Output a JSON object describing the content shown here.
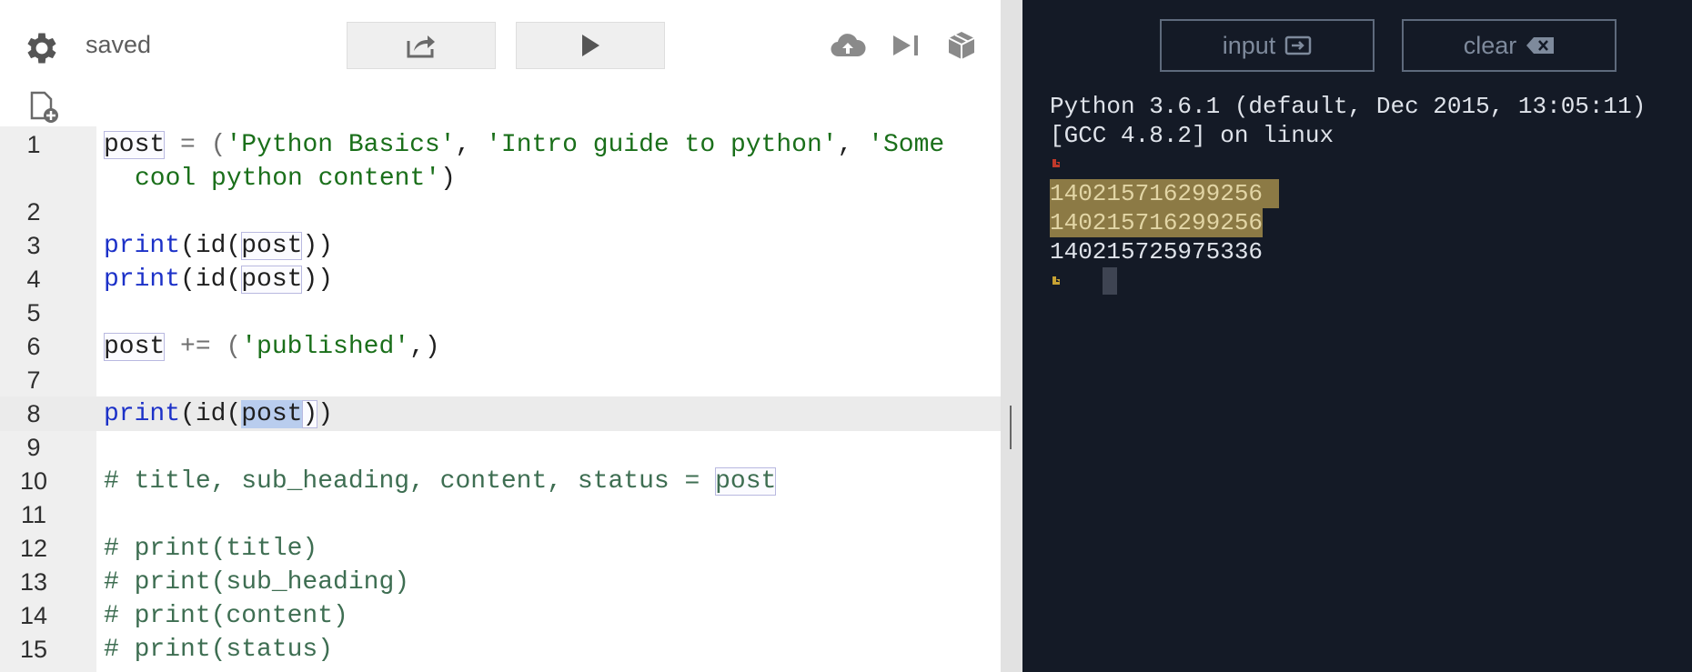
{
  "toolbar": {
    "status": "saved"
  },
  "editor": {
    "line_numbers": [
      "1",
      "2",
      "3",
      "4",
      "5",
      "6",
      "7",
      "8",
      "9",
      "10",
      "11",
      "12",
      "13",
      "14",
      "15"
    ],
    "current_line": "8",
    "code": {
      "l1a_var": "post",
      "l1a_op": " = (",
      "l1a_s1": "'Python Basics'",
      "l1a_c1": ", ",
      "l1a_s2": "'Intro guide to python'",
      "l1a_c2": ", ",
      "l1a_s3": "'Some",
      "l1b_s3": "cool python content'",
      "l1b_close": ")",
      "print_fn": "print",
      "id_open": "(id(",
      "var": "post",
      "close2": "))",
      "l6_op": " += (",
      "l6_str": "'published'",
      "l6_close": ",)",
      "id_fn": "id",
      "open_paren": "(",
      "l8_close1": ")",
      "l8_close2": ")",
      "l10_cmt": "# title, sub_heading, content, status = ",
      "l12": "# print(title)",
      "l13": "# print(sub_heading)",
      "l14": "# print(content)",
      "l15": "# print(status)"
    }
  },
  "console": {
    "input_label": "input",
    "clear_label": "clear",
    "banner_1": "Python 3.6.1 (default, Dec 2015, 13:05:11)",
    "banner_2": "[GCC 4.8.2] on linux",
    "output": [
      "140215716299256",
      "140215716299256",
      "140215725975336"
    ]
  },
  "colors": {
    "console_bg": "#141a26",
    "selection": "#8c7a45",
    "prompt": "#c7a233",
    "error_prompt": "#c0392b"
  }
}
